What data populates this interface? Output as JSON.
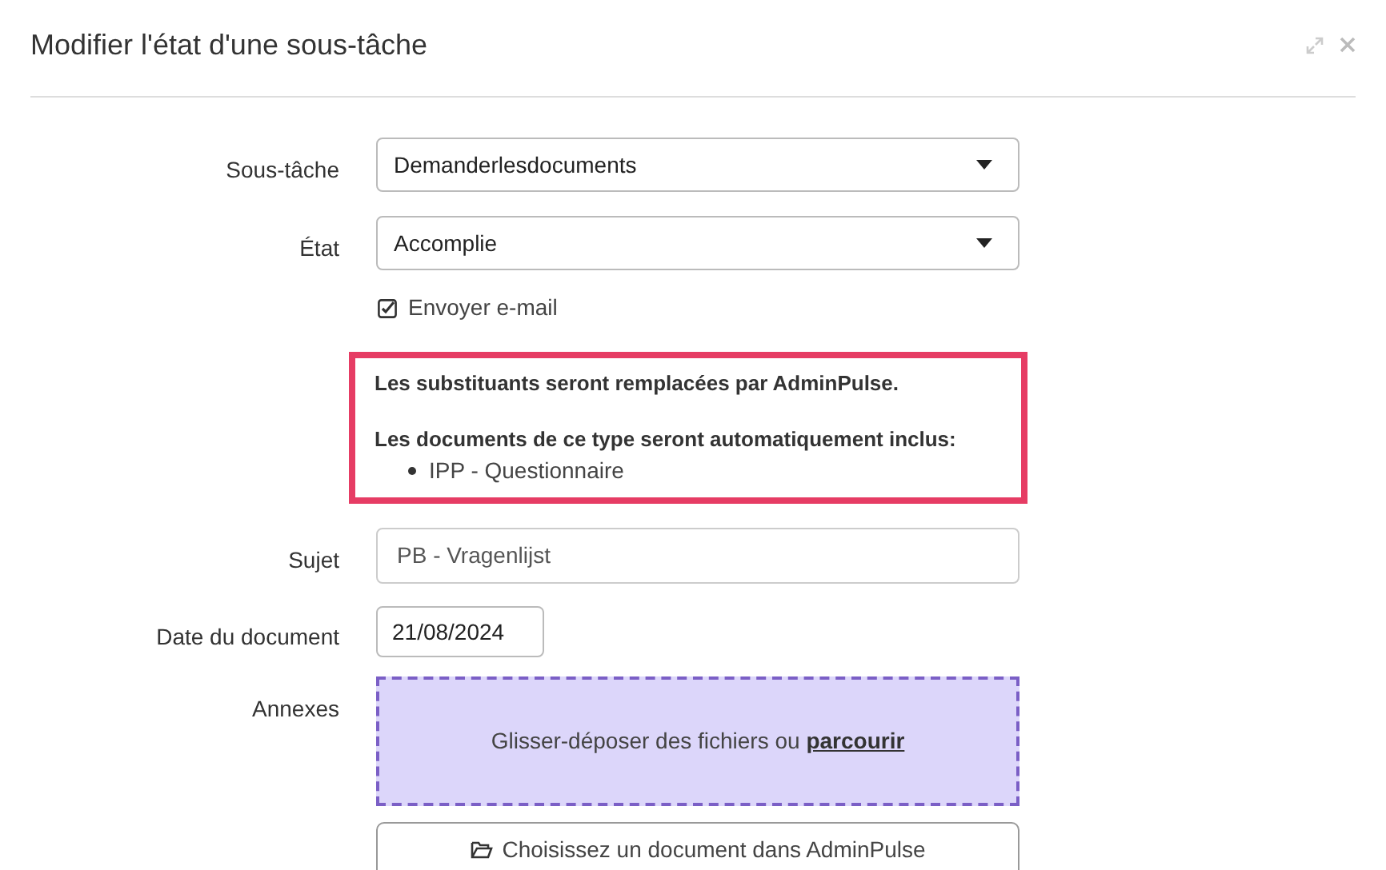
{
  "dialog": {
    "title": "Modifier l'état d'une sous-tâche"
  },
  "subtask": {
    "label": "Sous-tâche",
    "value": "Demanderlesdocuments"
  },
  "state": {
    "label": "État",
    "value": "Accomplie"
  },
  "send_email": {
    "label": "Envoyer e-mail",
    "checked": true
  },
  "notice": {
    "line_1": "Les substituants seront remplacées par AdminPulse.",
    "line_2": "Les documents de ce type seront automatiquement inclus:",
    "items": [
      "IPP - Questionnaire"
    ]
  },
  "subject": {
    "label": "Sujet",
    "value": "PB - Vragenlijst"
  },
  "document_date": {
    "label": "Date du document",
    "value": "21/08/2024"
  },
  "attachments": {
    "label": "Annexes",
    "dropzone_text": "Glisser-déposer des fichiers ou",
    "dropzone_link": "parcourir",
    "choose_button": "Choisissez un document dans AdminPulse"
  }
}
